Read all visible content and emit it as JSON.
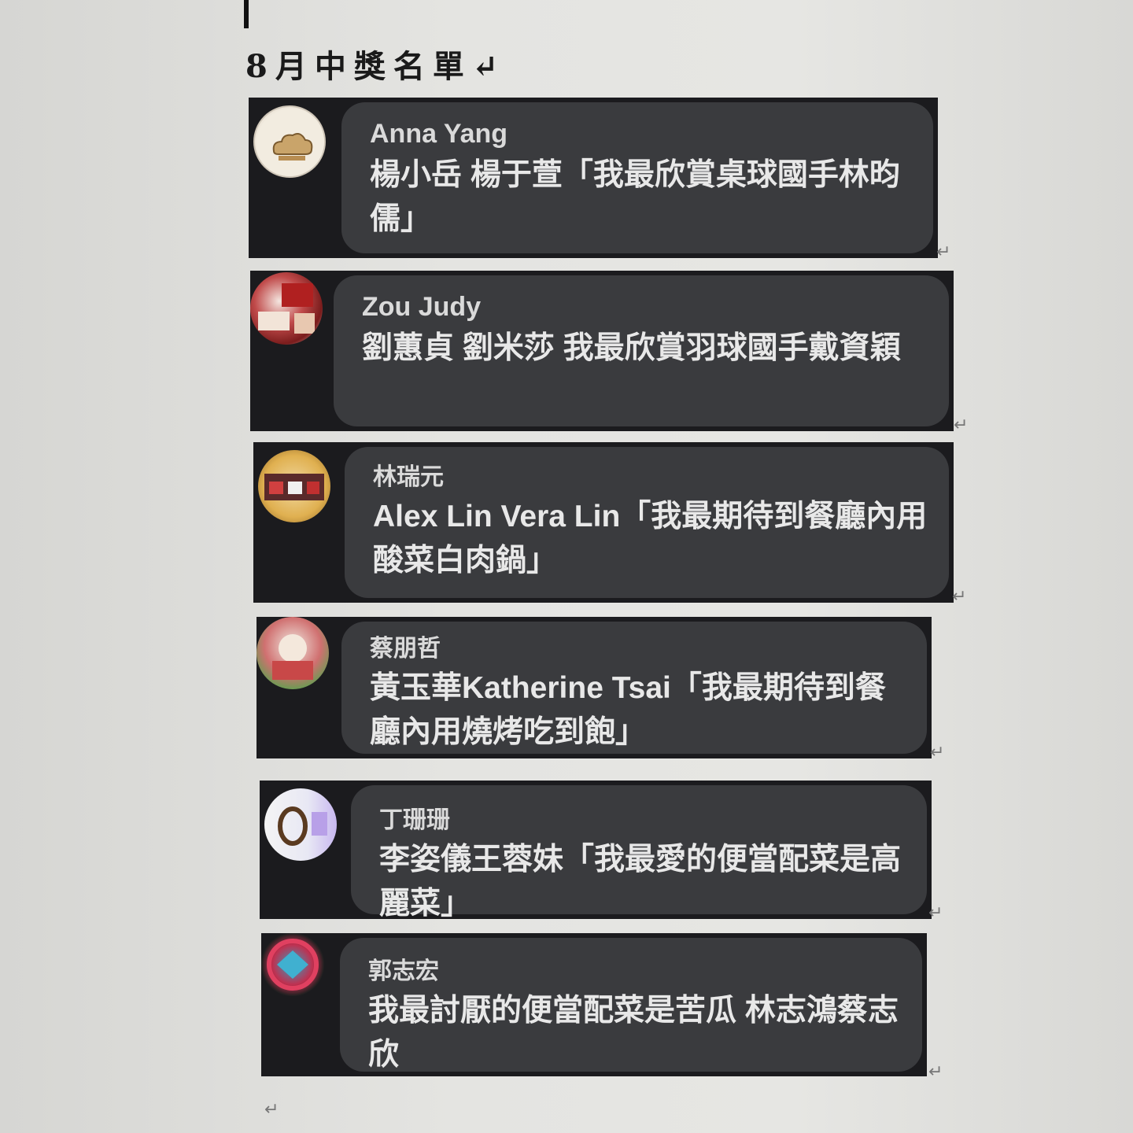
{
  "document": {
    "title": "8月中獎名單↵",
    "paragraph_mark": "↵"
  },
  "comments": [
    {
      "author": "Anna Yang",
      "text": "楊小岳 楊于萱「我最欣賞桌球國手林昀儒」",
      "avatar": "cloud-logo-avatar"
    },
    {
      "author": "Zou Judy",
      "text": "劉蕙貞 劉米莎 我最欣賞羽球國手戴資穎",
      "avatar": "photo-avatar"
    },
    {
      "author": "林瑞元",
      "text": "Alex Lin Vera Lin「我最期待到餐廳內用酸菜白肉鍋」",
      "avatar": "photo-avatar"
    },
    {
      "author": "蔡朋哲",
      "text": "黃玉華Katherine Tsai「我最期待到餐廳內用燒烤吃到飽」",
      "avatar": "photo-avatar"
    },
    {
      "author": "丁珊珊",
      "text": "李姿儀王蓉妹「我最愛的便當配菜是高麗菜」",
      "avatar": "photo-avatar"
    },
    {
      "author": "郭志宏",
      "text": "我最討厭的便當配菜是苦瓜 林志鴻蔡志欣",
      "avatar": "photo-avatar"
    }
  ]
}
